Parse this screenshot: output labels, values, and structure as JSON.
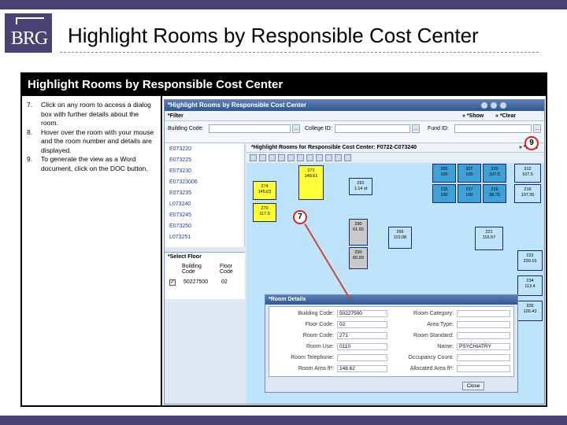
{
  "slide": {
    "logo_text": "BRG",
    "title": "Highlight Rooms by Responsible Cost Center"
  },
  "frame": {
    "header": "Highlight Rooms by Responsible Cost Center",
    "steps": [
      {
        "num": "7.",
        "text": "Click on any room to access a dialog box with further details about the room."
      },
      {
        "num": "8.",
        "text": "Hover over the room with your mouse and the room number and details are displayed."
      },
      {
        "num": "9.",
        "text": "To generate the view as a Word document, click on the DOC button."
      }
    ]
  },
  "app": {
    "title": "*Highlight Rooms by Responsible Cost Center",
    "filter_label": "*Filter",
    "show_label": "» *Show",
    "clear_label": "» *Clear",
    "building_code_label": "Building Code:",
    "college_id_label": "College ID:",
    "fund_id_label": "Fund ID:",
    "ellipsis": "...",
    "cost_centers": [
      "E073220",
      "E073225",
      "E073230",
      "E07323006",
      "E073235",
      "L073240",
      "E073245",
      "E073250",
      "L073251"
    ],
    "select_floor_label": "*Select Floor",
    "floor_col_building": "Building Code",
    "floor_col_floor": "Floor Code",
    "floor_row_building": "50227500",
    "floor_row_floor": "02",
    "plan_title": "*Highlight Rooms for Responsible Cost Center: F0722-C073240",
    "doc_label": "» *DOC"
  },
  "rooms": [
    {
      "name": "271",
      "area": "148.61"
    },
    {
      "name": "274",
      "area": "145.03"
    },
    {
      "name": "270",
      "area": "117.0"
    },
    {
      "name": "261",
      "area": "1:14 sf"
    },
    {
      "name": "305",
      "area": "100"
    },
    {
      "name": "307",
      "area": "100"
    },
    {
      "name": "310",
      "area": "107.5"
    },
    {
      "name": "312",
      "area": "107.5"
    },
    {
      "name": "215",
      "area": "100"
    },
    {
      "name": "217",
      "area": "100"
    },
    {
      "name": "219",
      "area": "98.75"
    },
    {
      "name": "216",
      "area": "107.95"
    },
    {
      "name": "290",
      "area": "61.65"
    },
    {
      "name": "290",
      "area": "65.09"
    },
    {
      "name": "266",
      "area": "110.08"
    },
    {
      "name": "221",
      "area": "116.57"
    },
    {
      "name": "222",
      "area": "239.16"
    },
    {
      "name": "234",
      "area": "113.4"
    },
    {
      "name": "326",
      "area": "126.43"
    }
  ],
  "room_details": {
    "title": "*Room Details",
    "fields_left": [
      {
        "label": "Building Code:",
        "value": "50227500"
      },
      {
        "label": "Floor Code:",
        "value": "02"
      },
      {
        "label": "Room Code:",
        "value": "271"
      },
      {
        "label": "Room Use:",
        "value": "0110"
      },
      {
        "label": "Room Telephone:",
        "value": ""
      },
      {
        "label": "Room Area ft²:",
        "value": "148.62"
      }
    ],
    "fields_right": [
      {
        "label": "Room Category:",
        "value": ""
      },
      {
        "label": "Area Type:",
        "value": ""
      },
      {
        "label": "Room Standard:",
        "value": ""
      },
      {
        "label": "Name:",
        "value": "PSYCHIATRY"
      },
      {
        "label": "Occupancy Count:",
        "value": ""
      },
      {
        "label": "Allocated Area ft²:",
        "value": ""
      }
    ],
    "close_label": "Close"
  },
  "callouts": {
    "seven": "7",
    "nine": "9"
  },
  "colors": {
    "brand": "#4a4270",
    "highlight_room": "#ffff3a",
    "callout_border": "#d0262a"
  }
}
